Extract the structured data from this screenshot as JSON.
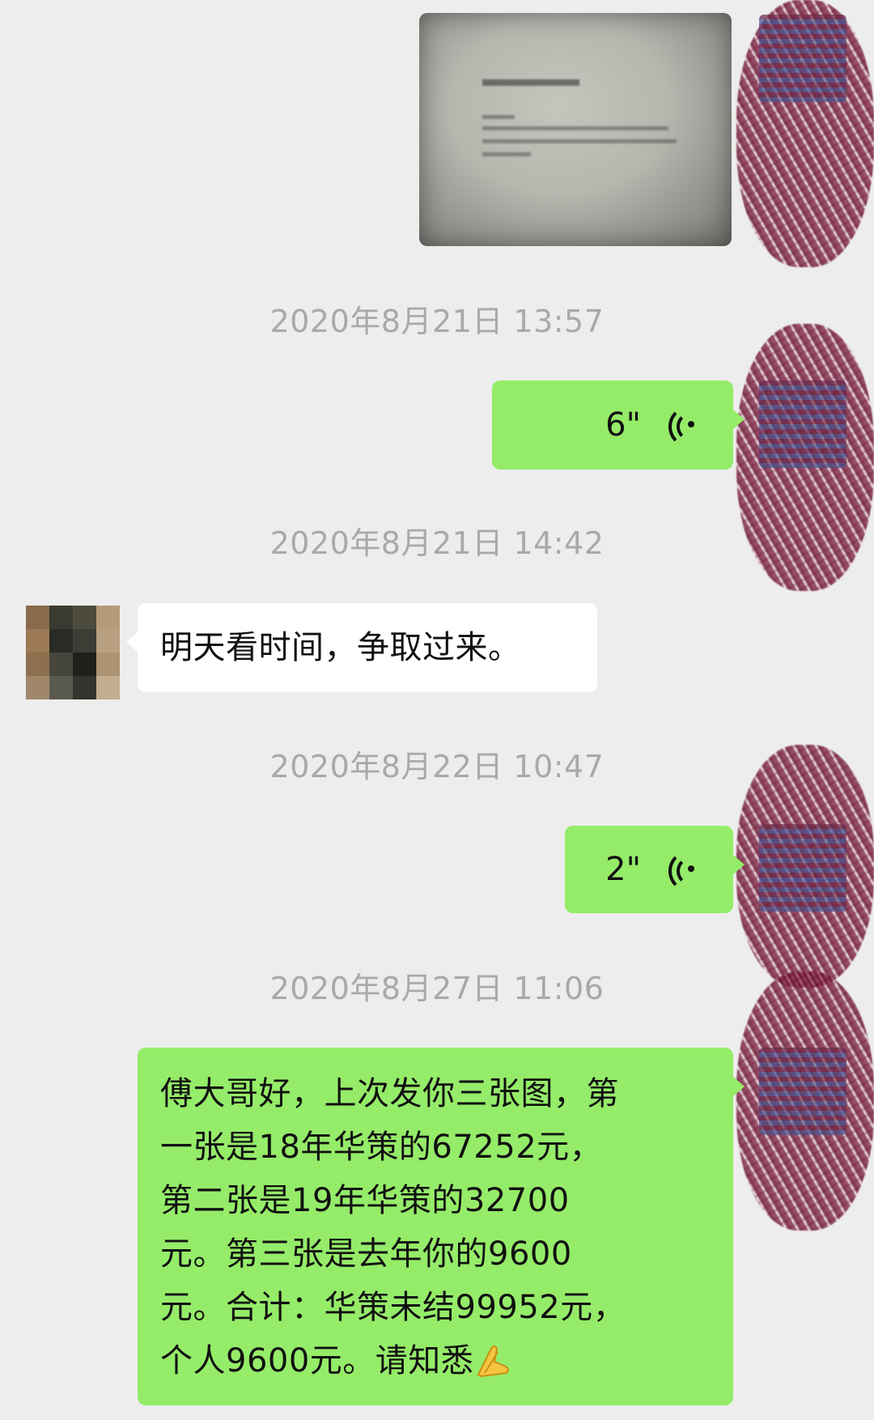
{
  "messages": {
    "image": {
      "kind": "image",
      "side": "right"
    },
    "ts1": "2020年8月21日 13:57",
    "voice1": {
      "duration": "6\"",
      "side": "right"
    },
    "ts2": "2020年8月21日 14:42",
    "text1": {
      "text": "明天看时间，争取过来。",
      "side": "left"
    },
    "ts3": "2020年8月22日 10:47",
    "voice2": {
      "duration": "2\"",
      "side": "right"
    },
    "ts4": "2020年8月27日 11:06",
    "text2": {
      "lines": [
        "傅大哥好，上次发你三张图，第",
        "一张是18年华策的67252元，",
        "第二张是19年华策的32700",
        "元。第三张是去年你的9600",
        "元。合计：华策未结99952元，",
        "个人9600元。请知悉"
      ],
      "emoji": "folded-hands-icon",
      "side": "right"
    }
  },
  "colors": {
    "background": "#ededed",
    "self_bubble": "#95ec69",
    "other_bubble": "#ffffff",
    "timestamp": "#a9a9a9"
  }
}
